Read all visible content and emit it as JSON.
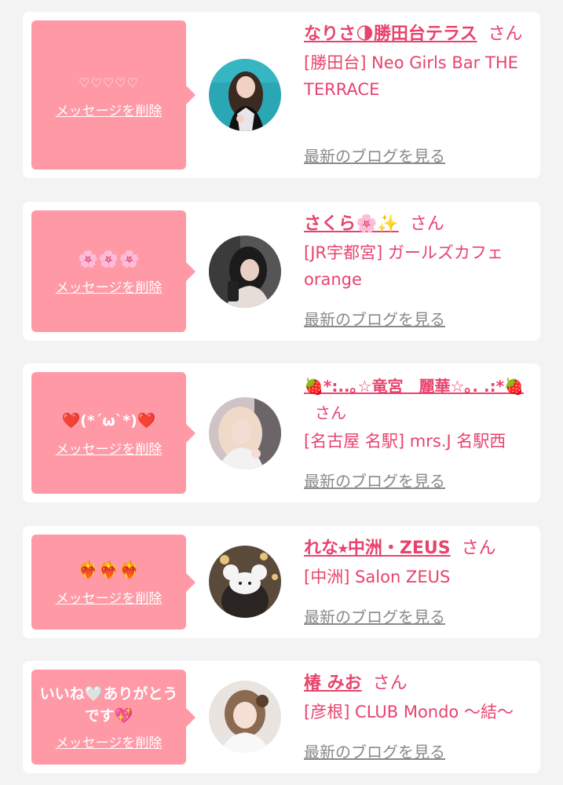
{
  "delete_label": "メッセージを削除",
  "blog_label": "最新のブログを見る",
  "san_label": "さん",
  "items": [
    {
      "message": "♡♡♡♡♡",
      "name": "なりさ🌗勝田台テラス",
      "shop": "[勝田台] Neo Girls Bar THE TERRACE",
      "avatar_icon": "girl-photo-1"
    },
    {
      "message": "🌸🌸🌸",
      "name": "さくら🌸✨",
      "shop": "[JR宇都宮] ガールズカフェ orange",
      "avatar_icon": "girl-photo-2"
    },
    {
      "message": "❤️(*´ω`*)❤️",
      "name": "🍓*:..｡☆竜宮　麗華☆｡. .:*🍓",
      "shop": "[名古屋 名駅] mrs.J 名駅西",
      "avatar_icon": "girl-photo-3"
    },
    {
      "message": "❤️‍🔥❤️‍🔥❤️‍🔥",
      "name": "れな⭑中洲・ZEUS",
      "shop": "[中洲] Salon ZEUS",
      "avatar_icon": "girl-photo-4"
    },
    {
      "message": "いいね🤍ありがとうです💖",
      "name": "椿 みお",
      "shop": "[彦根] CLUB Mondo 〜結〜",
      "avatar_icon": "girl-photo-5"
    }
  ]
}
